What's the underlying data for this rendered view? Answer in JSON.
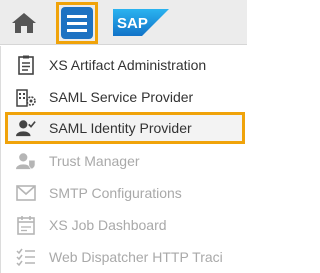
{
  "topbar": {
    "home_icon": "home-icon",
    "menu_icon": "hamburger-menu-icon",
    "logo_text": "SAP",
    "colors": {
      "accent": "#1d72c2",
      "highlight": "#f0a30a",
      "logo_blue": "#1a8fdd"
    }
  },
  "menu": {
    "items": [
      {
        "label": "XS Artifact Administration",
        "icon": "clipboard-list-icon",
        "enabled": true,
        "selected": false
      },
      {
        "label": "SAML Service Provider",
        "icon": "building-gear-icon",
        "enabled": true,
        "selected": false
      },
      {
        "label": "SAML Identity Provider",
        "icon": "user-check-icon",
        "enabled": true,
        "selected": true
      },
      {
        "label": "Trust Manager",
        "icon": "user-shield-icon",
        "enabled": false,
        "selected": false
      },
      {
        "label": "SMTP Configurations",
        "icon": "email-icon",
        "enabled": false,
        "selected": false
      },
      {
        "label": "XS Job Dashboard",
        "icon": "calendar-icon",
        "enabled": false,
        "selected": false
      },
      {
        "label": "Web Dispatcher HTTP Traci",
        "icon": "checklist-icon",
        "enabled": false,
        "selected": false
      }
    ]
  }
}
